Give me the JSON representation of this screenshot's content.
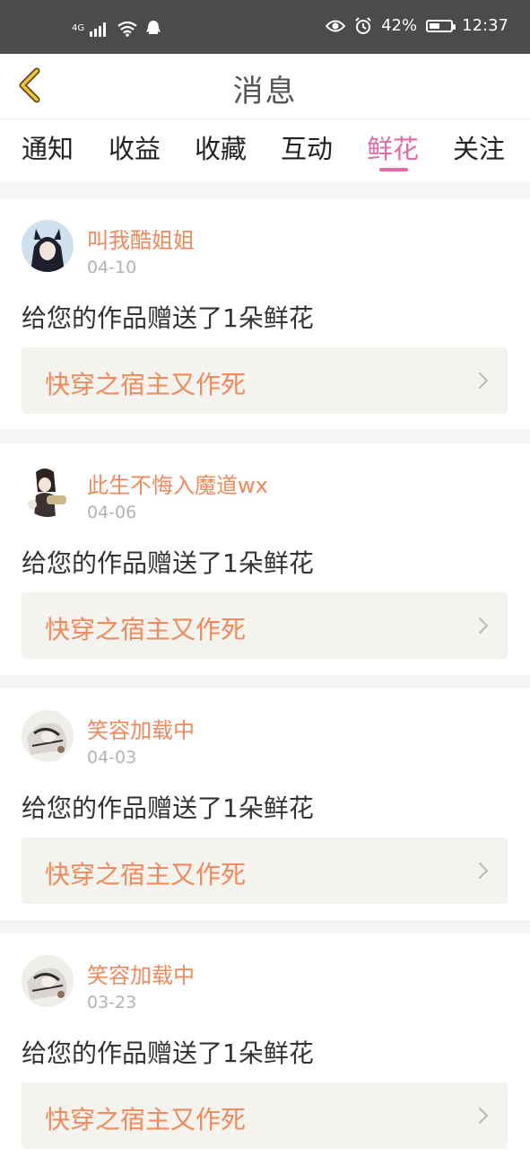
{
  "status_bar": {
    "network": "4G",
    "battery": "42%",
    "time": "12:37"
  },
  "header": {
    "title": "消息"
  },
  "tabs": [
    {
      "label": "通知"
    },
    {
      "label": "收益"
    },
    {
      "label": "收藏"
    },
    {
      "label": "互动"
    },
    {
      "label": "鲜花",
      "active": true
    },
    {
      "label": "关注"
    }
  ],
  "notifications": [
    {
      "user": "叫我酷姐姐",
      "date": "04-10",
      "message": "给您的作品赠送了1朵鲜花",
      "work": "快穿之宿主又作死"
    },
    {
      "user": "此生不悔入魔道wx",
      "date": "04-06",
      "message": "给您的作品赠送了1朵鲜花",
      "work": "快穿之宿主又作死"
    },
    {
      "user": "笑容加载中",
      "date": "04-03",
      "message": "给您的作品赠送了1朵鲜花",
      "work": "快穿之宿主又作死"
    },
    {
      "user": "笑容加载中",
      "date": "03-23",
      "message": "给您的作品赠送了1朵鲜花",
      "work": "快穿之宿主又作死"
    }
  ],
  "colors": {
    "accent": "#e46aa6",
    "username": "#f08a5d",
    "status_bar": "#4b4b4b"
  }
}
